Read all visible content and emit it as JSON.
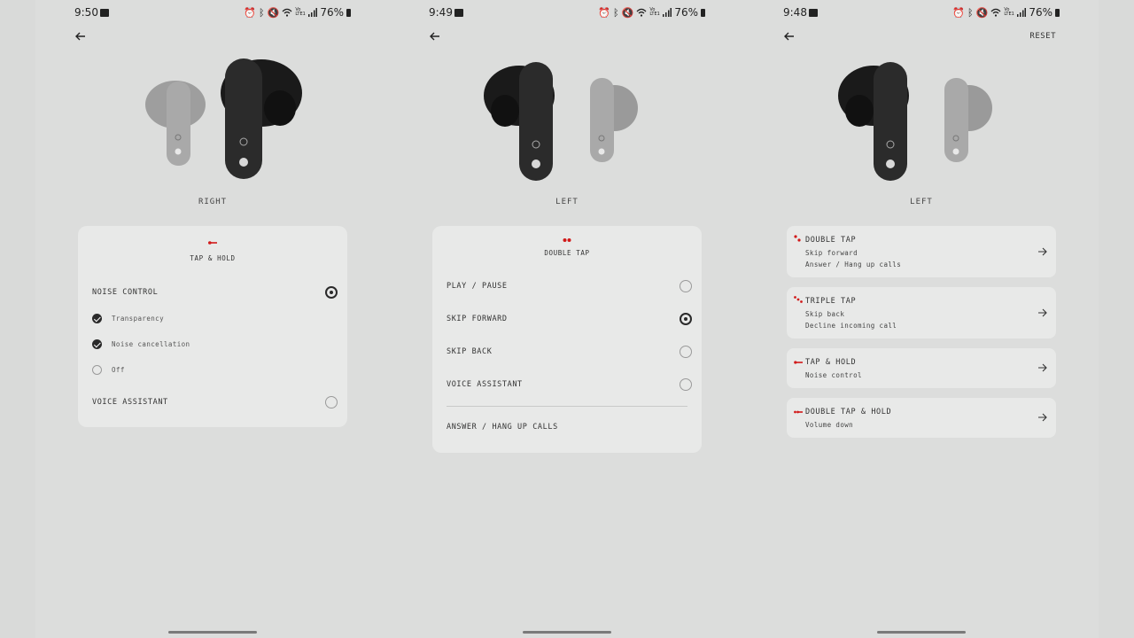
{
  "screens": [
    {
      "status": {
        "time": "9:50",
        "battery": "76%",
        "network": "Vo LTE1"
      },
      "side_label": "RIGHT",
      "card": {
        "header_title": "TAP & HOLD",
        "noise_control_label": "NOISE CONTROL",
        "sub_options": [
          "Transparency",
          "Noise cancellation",
          "Off"
        ],
        "voice_assistant_label": "VOICE ASSISTANT"
      }
    },
    {
      "status": {
        "time": "9:49",
        "battery": "76%",
        "network": "Vo LTE1"
      },
      "side_label": "LEFT",
      "card": {
        "header_title": "DOUBLE TAP",
        "options": [
          "PLAY / PAUSE",
          "SKIP FORWARD",
          "SKIP BACK",
          "VOICE ASSISTANT"
        ],
        "selected_option": "SKIP FORWARD",
        "extra_option": "ANSWER / HANG UP CALLS"
      }
    },
    {
      "status": {
        "time": "9:48",
        "battery": "76%",
        "network": "Vo LTE1"
      },
      "reset_label": "RESET",
      "side_label": "LEFT",
      "gestures": [
        {
          "title": "DOUBLE TAP",
          "lines": [
            "Skip forward",
            "Answer / Hang up calls"
          ]
        },
        {
          "title": "TRIPLE TAP",
          "lines": [
            "Skip back",
            "Decline incoming call"
          ]
        },
        {
          "title": "TAP & HOLD",
          "lines": [
            "Noise control"
          ]
        },
        {
          "title": "DOUBLE TAP & HOLD",
          "lines": [
            "Volume down"
          ]
        }
      ]
    }
  ],
  "colors": {
    "accent_red": "#d11a1a",
    "background": "#dcdddc",
    "card": "#e8e9e8",
    "text": "#2a2a2a"
  },
  "icons": [
    "back-arrow-icon",
    "gallery-icon",
    "alarm-icon",
    "bluetooth-icon",
    "mute-icon",
    "wifi-icon",
    "signal-icon",
    "battery-icon",
    "radio-button",
    "check-circle-icon",
    "chevron-right-arrow-icon",
    "tap-hold-gesture-icon",
    "double-tap-gesture-icon",
    "triple-tap-gesture-icon",
    "double-tap-hold-gesture-icon"
  ]
}
